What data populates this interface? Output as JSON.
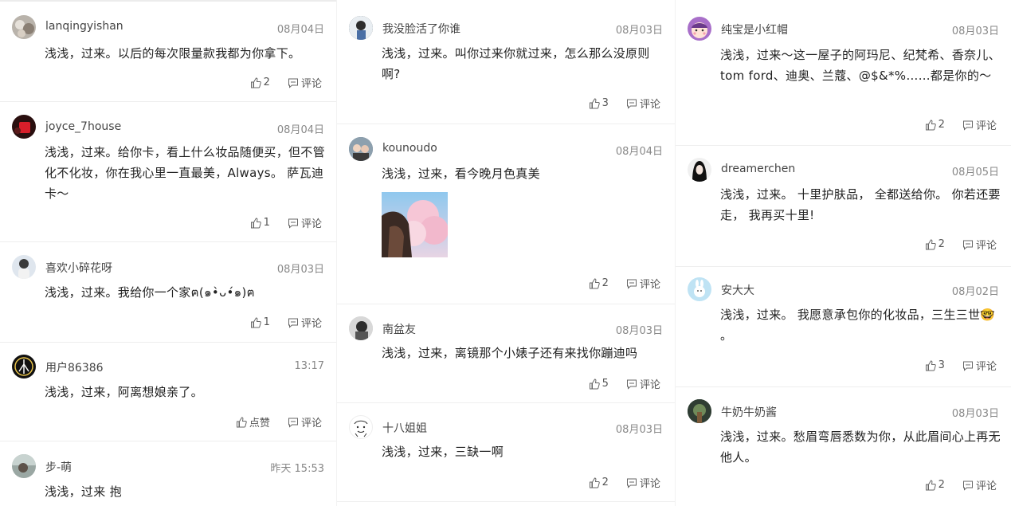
{
  "action_label": "评论",
  "columns": [
    [
      {
        "user": "lanqingyishan",
        "date": "08月04日",
        "text": "浅浅，过来。以后的每次限量款我都为你拿下。",
        "likes": "2"
      },
      {
        "user": "joyce_7house",
        "date": "08月04日",
        "text": "浅浅，过来。给你卡，看上什么妆品随便买，但不管化不化妆，你在我心里一直最美，Always。 萨瓦迪卡～",
        "likes": "1"
      },
      {
        "user": "喜欢小碎花呀",
        "date": "08月03日",
        "text": "浅浅，过来。我给你一个家ฅ(๑•̀ᴗ•́๑)ฅ",
        "likes": "1"
      },
      {
        "user": "用户86386",
        "date": "13:17",
        "text": "浅浅，过来，阿离想娘亲了。",
        "likes": "点赞"
      },
      {
        "user": "步-萌",
        "date": "昨天 15:53",
        "text": "浅浅，过来 抱",
        "likes": ""
      }
    ],
    [
      {
        "user": "我没脸活了你谁",
        "date": "08月03日",
        "text": "浅浅，过来。叫你过来你就过来，怎么那么没原则啊?",
        "likes": "3"
      },
      {
        "user": "kounoudo",
        "date": "08月04日",
        "text": "浅浅，过来，看今晚月色真美",
        "likes": "2"
      },
      {
        "user": "南盆友",
        "date": "08月03日",
        "text": "浅浅，过来，离镜那个小婊子还有来找你蹦迪吗",
        "likes": "5"
      },
      {
        "user": "十八姐姐",
        "date": "08月03日",
        "text": "浅浅，过来，三缺一啊",
        "likes": "2"
      }
    ],
    [
      {
        "user": "纯宝是小红帽",
        "date": "08月03日",
        "text": "浅浅，过来～这一屋子的阿玛尼、纪梵希、香奈儿、tom ford、迪奥、兰蔻、@$&*%……都是你的～",
        "likes": "2"
      },
      {
        "user": "dreamerchen",
        "date": "08月05日",
        "text": "浅浅，过来。 十里护肤品， 全都送给你。 你若还要走， 我再买十里!",
        "likes": "2"
      },
      {
        "user": "安大大",
        "date": "08月02日",
        "text": "浅浅，过来。 我愿意承包你的化妆品，三生三世🤓 。",
        "likes": "3"
      },
      {
        "user": "牛奶牛奶酱",
        "date": "08月03日",
        "text": "浅浅，过来。愁眉弯唇悉数为你，从此眉间心上再无他人。",
        "likes": "2"
      }
    ]
  ],
  "colors": {
    "text": "#222222",
    "meta": "#888888",
    "divider": "#eeeeee"
  }
}
